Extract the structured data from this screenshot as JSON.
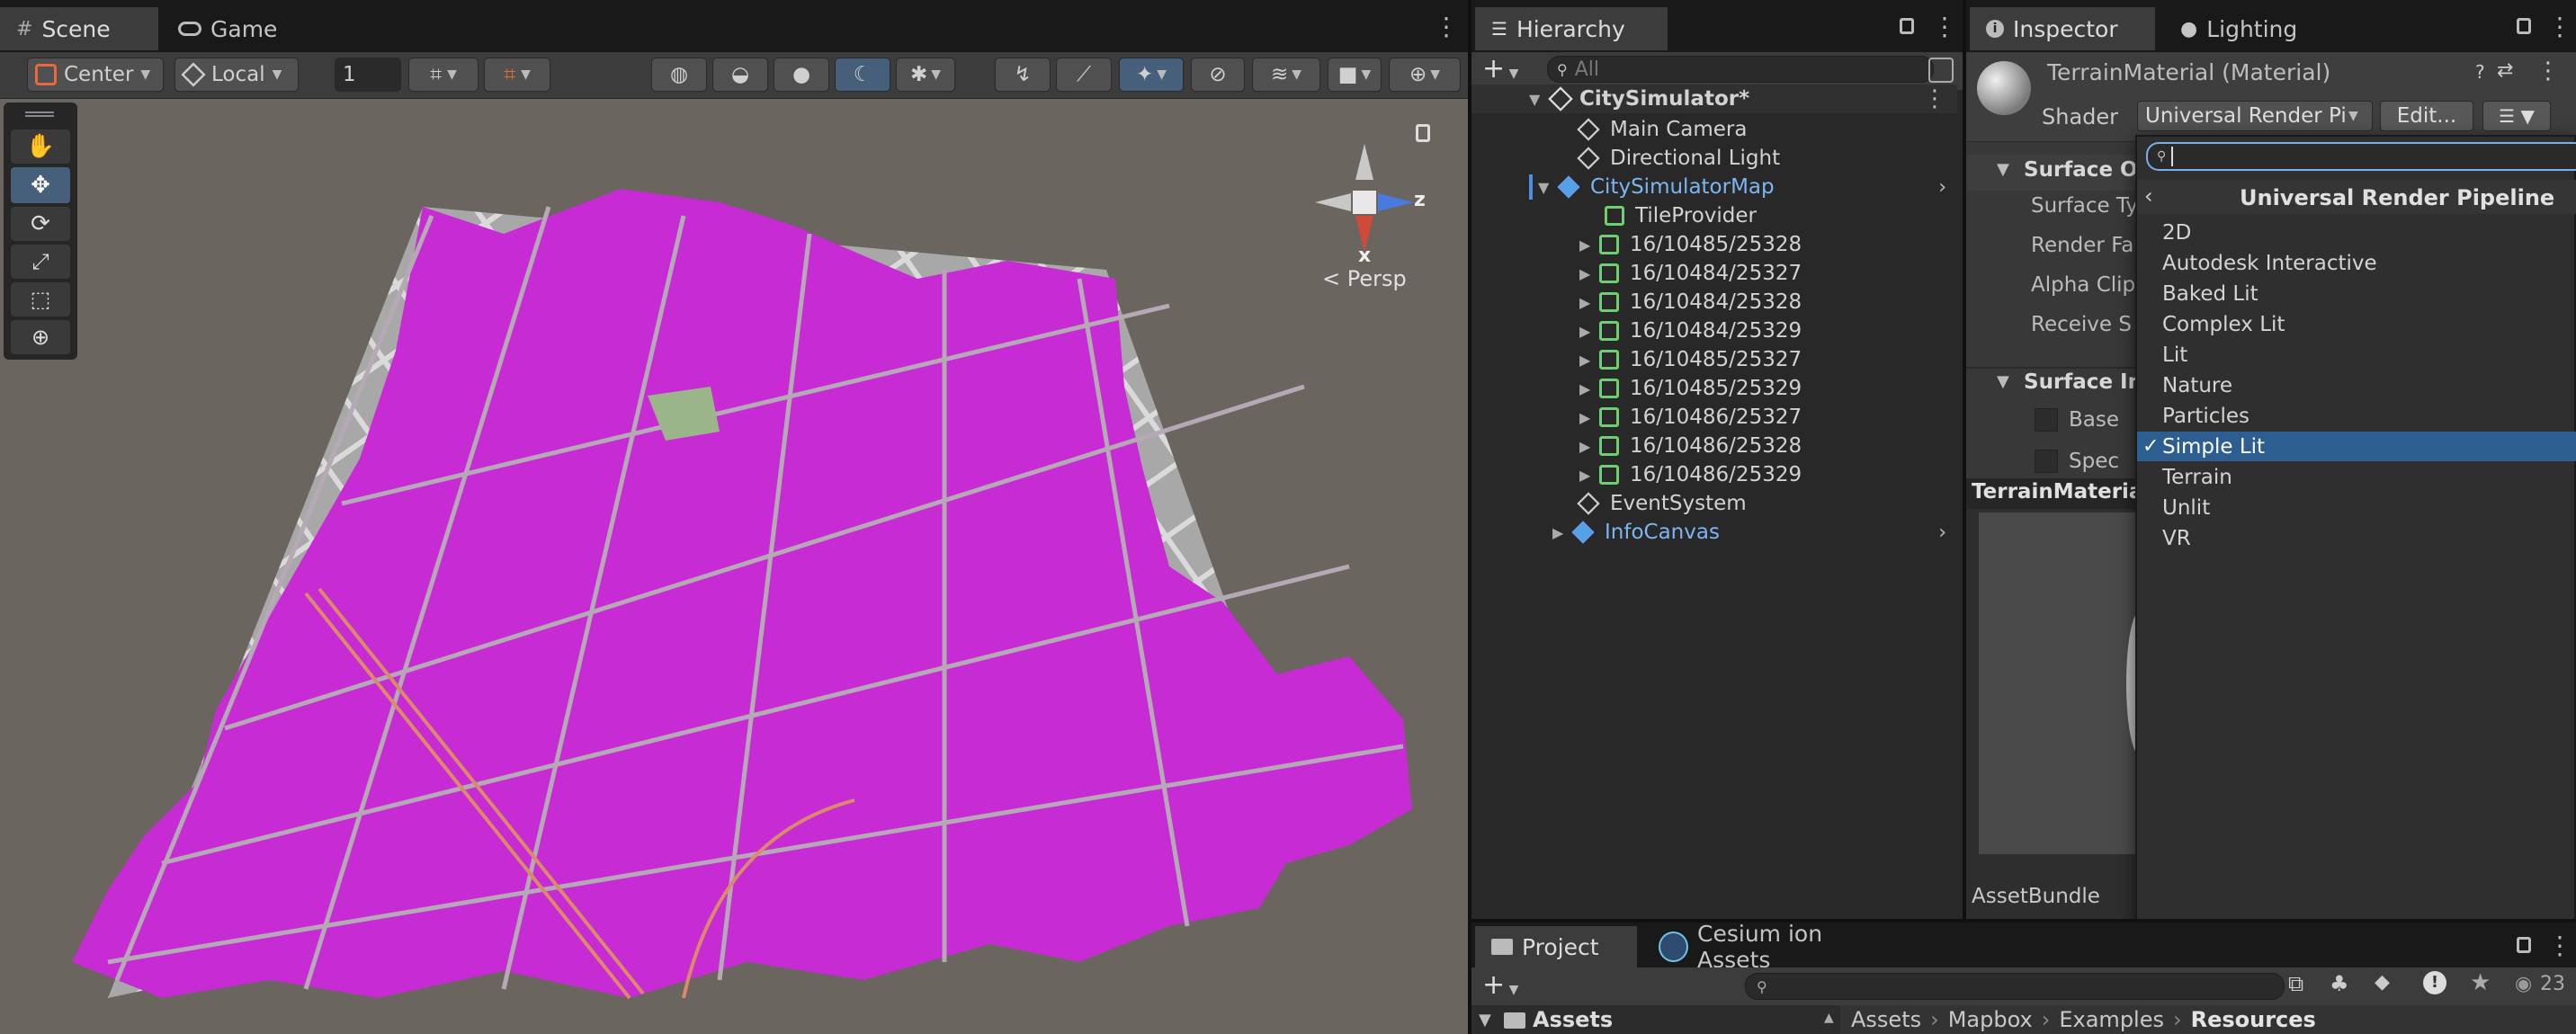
{
  "scene_tabs": [
    {
      "label": "Scene",
      "icon": "hash-icon"
    },
    {
      "label": "Game",
      "icon": "gamepad-icon"
    }
  ],
  "scene_toolbar": {
    "pivot": "Center",
    "space": "Local",
    "grid_value": "1",
    "persp_label": "< Persp",
    "gizmo_z": "z",
    "gizmo_x": "x"
  },
  "hierarchy": {
    "tab": "Hierarchy",
    "search_placeholder": "All",
    "items": [
      {
        "label": "CitySimulator*",
        "bold": true
      },
      {
        "label": "Main Camera"
      },
      {
        "label": "Directional Light"
      },
      {
        "label": "CitySimulatorMap",
        "prefab": true
      },
      {
        "label": "TileProvider"
      },
      {
        "label": "16/10485/25328"
      },
      {
        "label": "16/10484/25327"
      },
      {
        "label": "16/10484/25328"
      },
      {
        "label": "16/10484/25329"
      },
      {
        "label": "16/10485/25327"
      },
      {
        "label": "16/10485/25329"
      },
      {
        "label": "16/10486/25327"
      },
      {
        "label": "16/10486/25328"
      },
      {
        "label": "16/10486/25329"
      },
      {
        "label": "EventSystem"
      },
      {
        "label": "InfoCanvas",
        "prefab": true
      }
    ]
  },
  "inspector": {
    "tab_inspector": "Inspector",
    "tab_lighting": "Lighting",
    "material_name": "TerrainMaterial (Material)",
    "shader_label": "Shader",
    "shader_value": "Universal Render Pip",
    "edit_button": "Edit...",
    "surface_options": "Surface Op",
    "surface_type": "Surface Ty",
    "render_face": "Render Fa",
    "alpha_clip": "Alpha Clip",
    "receive_shadows": "Receive S",
    "surface_inputs": "Surface In",
    "base_map": "Base",
    "specular_map": "Spec",
    "preview_title": "TerrainMaterial",
    "asset_bundle": "AssetBundle"
  },
  "shader_menu": {
    "header": "Universal Render Pipeline",
    "items": [
      "2D",
      "Autodesk Interactive",
      "Baked Lit",
      "Complex Lit",
      "Lit",
      "Nature",
      "Particles",
      "Simple Lit",
      "Terrain",
      "Unlit",
      "VR"
    ],
    "selected": "Simple Lit",
    "check": "✓"
  },
  "project": {
    "tab_project": "Project",
    "tab_cesium": "Cesium ion Assets",
    "assets_label": "Assets",
    "breadcrumb": [
      "Assets",
      "Mapbox",
      "Examples",
      "Resources"
    ],
    "visible_count": "23"
  },
  "colors": {
    "building": "#c72bd3",
    "ground": "#9a9a9a",
    "road": "#d8d8d8",
    "selection": "#2c5d87",
    "prefab_text": "#7cb6f0"
  }
}
